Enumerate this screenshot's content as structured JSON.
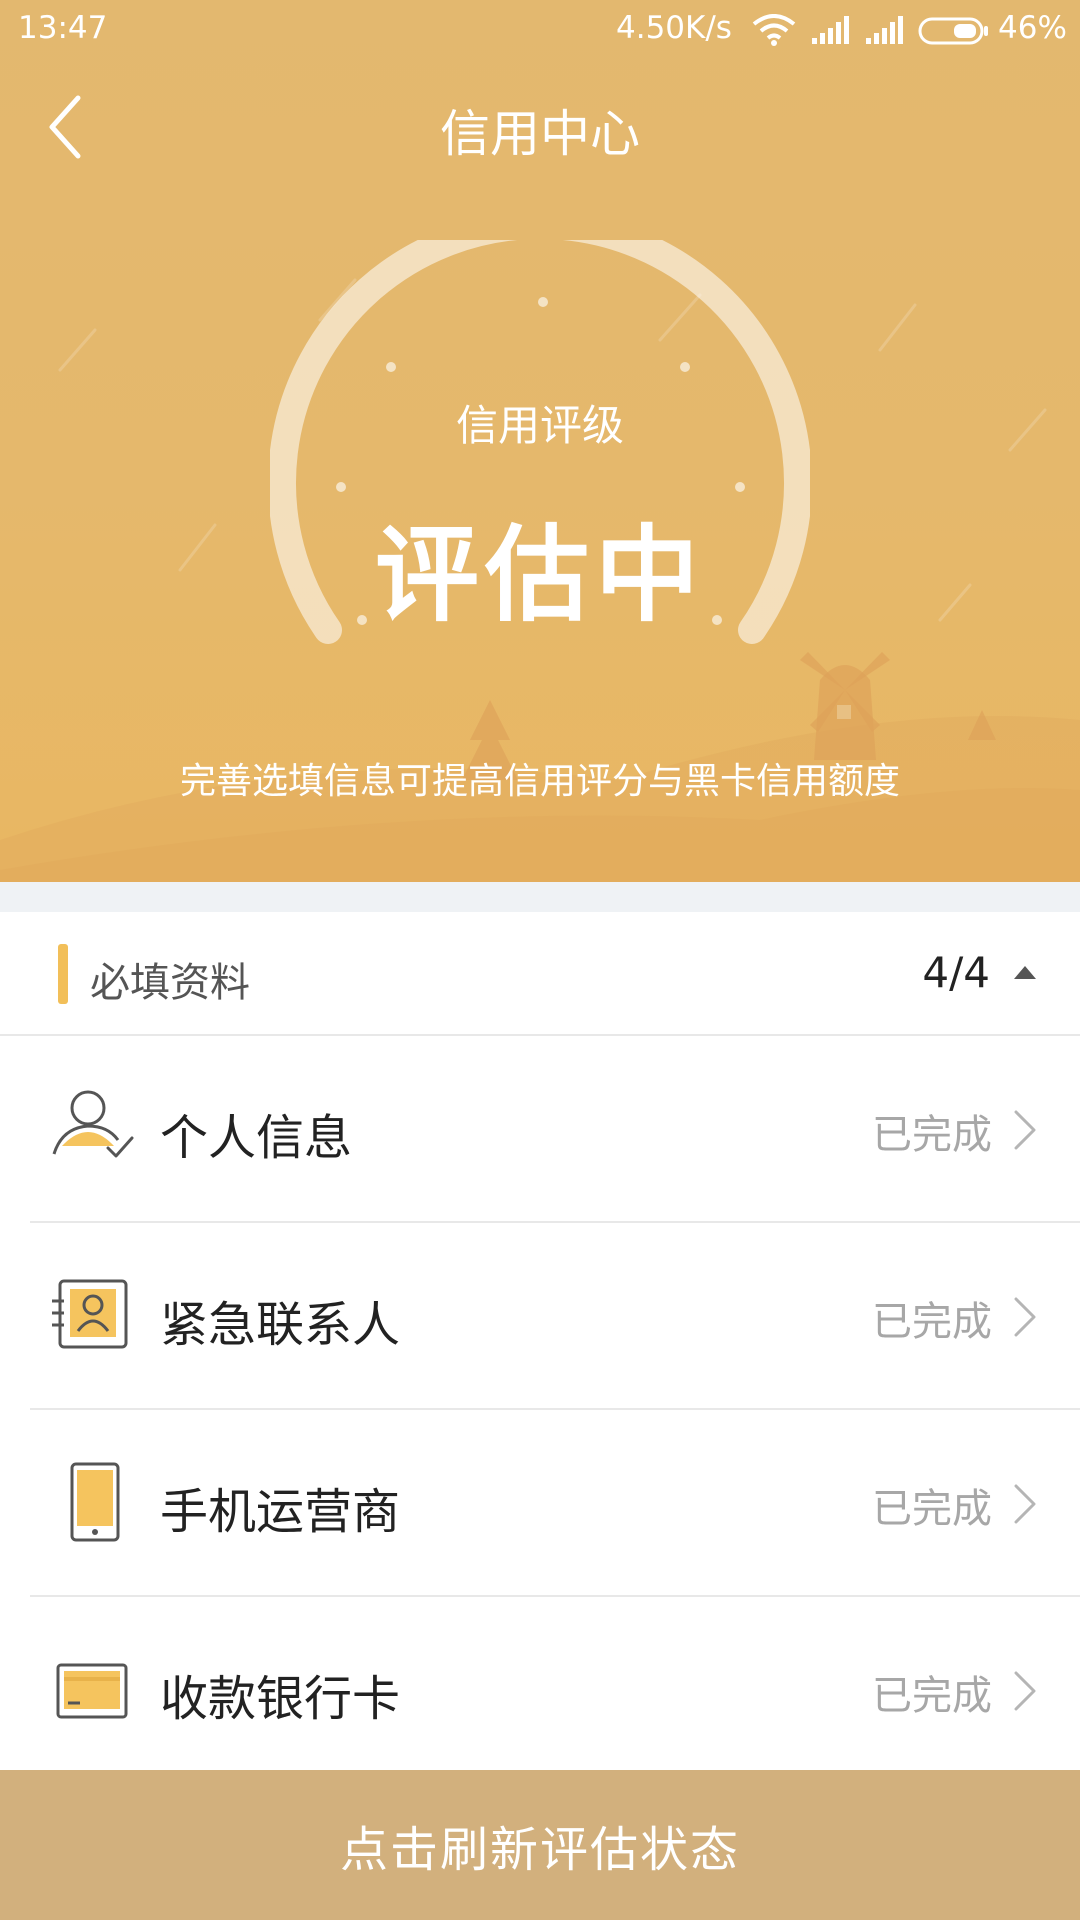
{
  "status_bar": {
    "time": "13:47",
    "network_speed": "4.50K/s",
    "battery_percent": "46%",
    "icons": [
      "wifi-icon",
      "signal-icon",
      "signal-icon",
      "battery-icon"
    ]
  },
  "header": {
    "title": "信用中心",
    "back_icon": "chevron-left-icon"
  },
  "credit": {
    "rating_label": "信用评级",
    "rating_value": "评估中",
    "hint": "完善选填信息可提高信用评分与黑卡信用额度"
  },
  "section": {
    "title": "必填资料",
    "progress": "4/4",
    "toggle_icon": "caret-up-icon"
  },
  "items": [
    {
      "label": "个人信息",
      "status": "已完成",
      "icon": "person-check-icon"
    },
    {
      "label": "紧急联系人",
      "status": "已完成",
      "icon": "contact-card-icon"
    },
    {
      "label": "手机运营商",
      "status": "已完成",
      "icon": "mobile-phone-icon"
    },
    {
      "label": "收款银行卡",
      "status": "已完成",
      "icon": "bank-card-icon"
    }
  ],
  "action": {
    "refresh_label": "点击刷新评估状态"
  },
  "colors": {
    "hero": "#e4b86c",
    "accent": "#f2bf59",
    "button": "#d2b07d",
    "divider_bg": "#eff2f5"
  }
}
